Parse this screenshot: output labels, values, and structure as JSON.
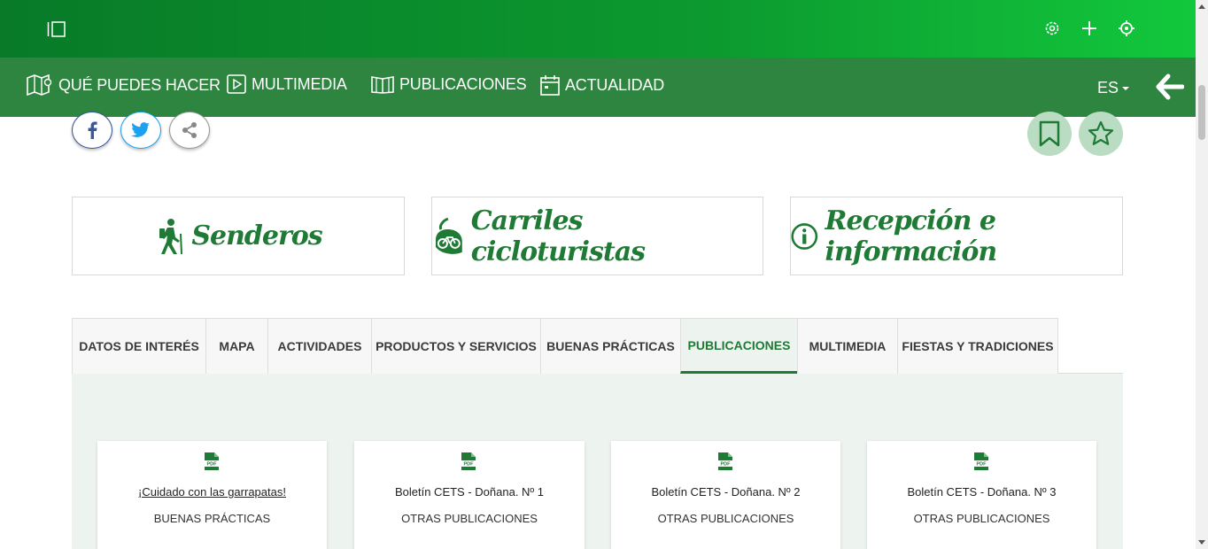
{
  "nav": {
    "items": [
      {
        "label": "QUÉ PUEDES HACER",
        "icon": "map-icon"
      },
      {
        "label": "MULTIMEDIA",
        "icon": "play-icon"
      },
      {
        "label": "PUBLICACIONES",
        "icon": "book-icon"
      },
      {
        "label": "ACTUALIDAD",
        "icon": "calendar-icon"
      }
    ],
    "language": "ES"
  },
  "categories": [
    {
      "label": "Senderos",
      "icon": "hiker-icon"
    },
    {
      "label": "Carriles cicloturistas",
      "icon": "bicycle-icon"
    },
    {
      "label": "Recepción e información",
      "icon": "info-icon"
    }
  ],
  "tabs": [
    {
      "label": "DATOS DE INTERÉS",
      "active": false
    },
    {
      "label": "MAPA",
      "active": false
    },
    {
      "label": "ACTIVIDADES",
      "active": false
    },
    {
      "label": "PRODUCTOS Y SERVICIOS",
      "active": false
    },
    {
      "label": "BUENAS PRÁCTICAS",
      "active": false
    },
    {
      "label": "PUBLICACIONES",
      "active": true
    },
    {
      "label": "MULTIMEDIA",
      "active": false
    },
    {
      "label": "FIESTAS Y TRADICIONES",
      "active": false
    }
  ],
  "publications": [
    {
      "title": "¡Cuidado con las garrapatas!",
      "category": "BUENAS PRÁCTICAS",
      "file_icon": "pdf-icon"
    },
    {
      "title": "Boletín CETS - Doñana. Nº 1",
      "category": "OTRAS PUBLICACIONES",
      "file_icon": "pdf-icon"
    },
    {
      "title": "Boletín CETS - Doñana. Nº 2",
      "category": "OTRAS PUBLICACIONES",
      "file_icon": "pdf-icon"
    },
    {
      "title": "Boletín CETS - Doñana. Nº 3",
      "category": "OTRAS PUBLICACIONES",
      "file_icon": "pdf-icon"
    }
  ],
  "colors": {
    "brand_green": "#1e7a34",
    "nav_green": "#2d8540",
    "content_bg": "#edf3ee"
  }
}
